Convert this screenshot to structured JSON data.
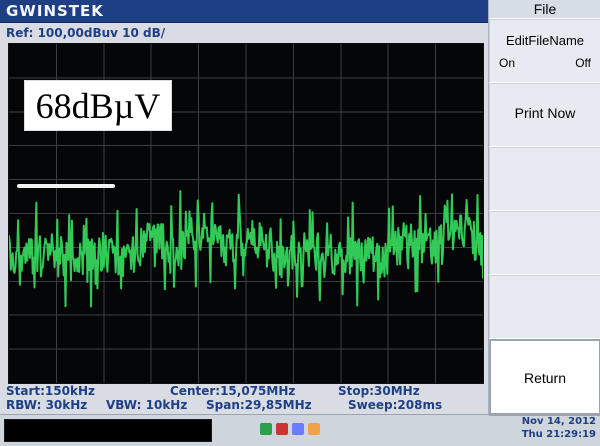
{
  "brand": {
    "name": "GWINSTEK"
  },
  "ref": {
    "text": "Ref:  100,00dBuv  10 dB/"
  },
  "plot": {
    "level_label": "68dBµV",
    "colors": {
      "grid": "#3b3f45",
      "trace": "#35d45c",
      "background": "#050608"
    }
  },
  "bottom_info": {
    "start": "Start:150kHz",
    "center": "Center:15,075MHz",
    "stop": "Stop:30MHz",
    "rbw": "RBW: 30kHz",
    "vbw": "VBW: 10kHz",
    "span": "Span:29,85MHz",
    "sweep": "Sweep:208ms"
  },
  "status": {
    "date": "Nov 14, 2012",
    "time": "Thu 21:29:19"
  },
  "right_panel": {
    "title": "File",
    "keys": [
      {
        "label": "EditFileName",
        "opt_on": "On",
        "opt_off": "Off"
      },
      {
        "label": "Print Now"
      },
      {
        "label": ""
      },
      {
        "label": ""
      },
      {
        "label": ""
      },
      {
        "label": "Return"
      }
    ]
  },
  "icons": {
    "status_icons": [
      "usb-icon",
      "power-icon",
      "lan-icon",
      "network-icon"
    ]
  }
}
